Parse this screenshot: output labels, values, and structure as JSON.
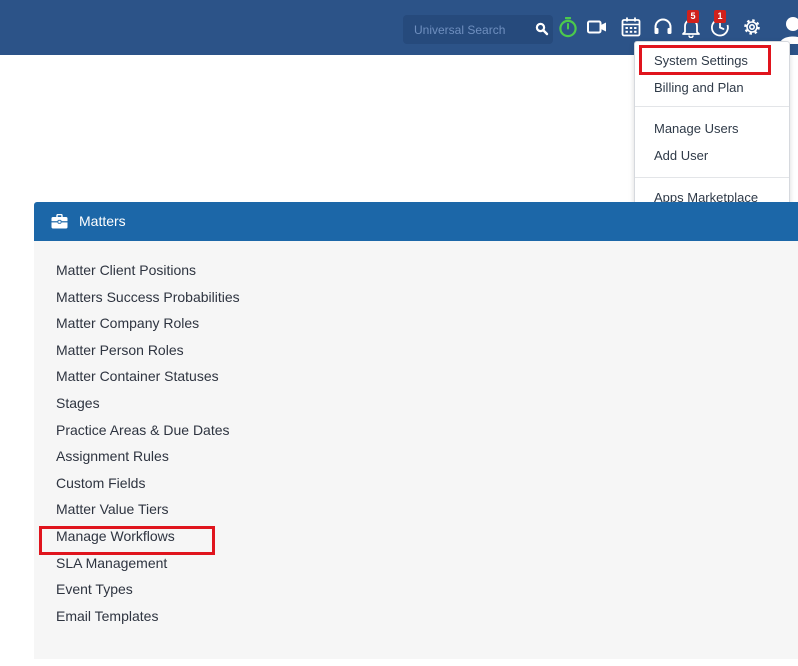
{
  "topbar": {
    "search": {
      "placeholder": "Universal Search"
    },
    "badges": {
      "notifications": "5",
      "reminders": "1"
    }
  },
  "settings_menu": {
    "items": [
      {
        "label": "System Settings",
        "highlighted": true
      },
      {
        "label": "Billing and Plan"
      },
      {
        "label": "Manage Users"
      },
      {
        "label": "Add User"
      },
      {
        "label": "Apps Marketplace"
      }
    ]
  },
  "matters_panel": {
    "title": "Matters",
    "links": [
      "Matter Client Positions",
      "Matters Success Probabilities",
      "Matter Company Roles",
      "Matter Person Roles",
      "Matter Container Statuses",
      "Stages",
      "Practice Areas & Due Dates",
      "Assignment Rules",
      "Custom Fields",
      "Matter Value Tiers",
      "Manage Workflows",
      "SLA Management",
      "Event Types",
      "Email Templates"
    ],
    "highlighted_link": "Manage Workflows"
  },
  "colors": {
    "topbar": "#2c5388",
    "panel_header": "#1c67a8",
    "panel_body": "#f6f6f6",
    "highlight": "#e0141d",
    "timer_icon": "#4cc94c"
  },
  "icons": [
    "search-icon",
    "timer-icon",
    "video-icon",
    "calendar-icon",
    "headset-icon",
    "bell-icon",
    "reminder-icon",
    "gear-icon",
    "avatar-icon",
    "briefcase-icon"
  ]
}
